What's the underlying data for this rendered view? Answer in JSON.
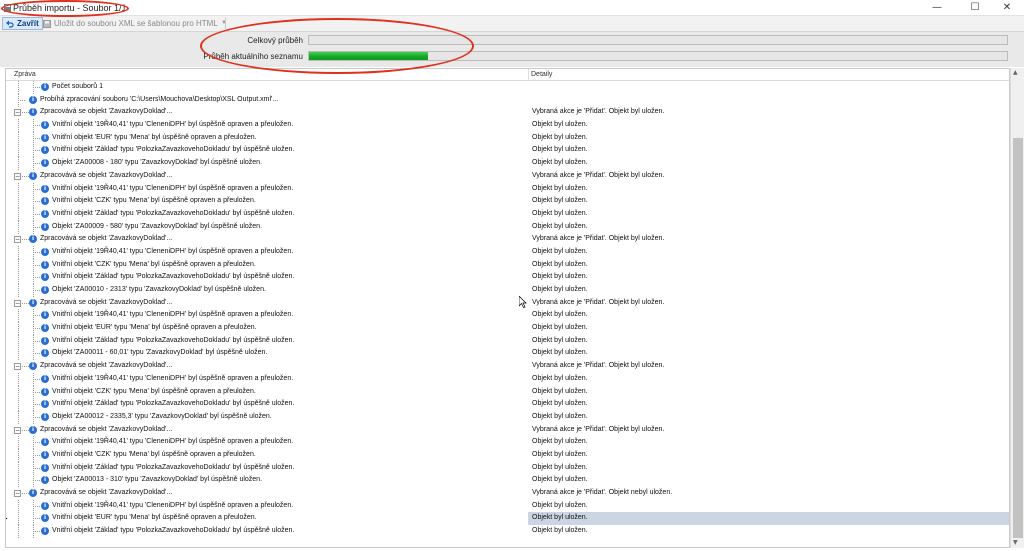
{
  "window": {
    "title": "Průběh importu - Soubor 1/1",
    "buttons": {
      "minimize": "—",
      "maximize": "☐",
      "close": "✕"
    }
  },
  "toolbar": {
    "close_label": "Zavřít",
    "save_label": "Uložit do souboru XML se šablonou pro HTML"
  },
  "progress": {
    "total_label": "Celkový průběh",
    "total_value": 0,
    "current_label": "Průběh aktuálního seznamu",
    "current_value": 0.17
  },
  "grid": {
    "columns": [
      "Zpráva",
      "Detaily"
    ],
    "rows": [
      {
        "level": 2,
        "message": "Počet souborů 1",
        "detail": ""
      },
      {
        "level": 1,
        "message": "Probíhá zpracování souboru 'C:\\Users\\Mouchova\\Desktop\\XSL Output.xml'...",
        "detail": ""
      },
      {
        "level": 1,
        "expand": true,
        "message": "Zpracovává se objekt 'ZavazkovyDoklad'...",
        "detail": "Vybraná akce je 'Přidat'. Objekt byl uložen."
      },
      {
        "level": 2,
        "message": "Vnitřní objekt '19Ř40,41' typu 'CleneniDPH' byl úspěšně opraven a přeuložen.",
        "detail": "Objekt byl uložen."
      },
      {
        "level": 2,
        "message": "Vnitřní objekt 'EUR' typu 'Mena' byl úspěšně opraven a přeuložen.",
        "detail": "Objekt byl uložen."
      },
      {
        "level": 2,
        "message": "Vnitřní objekt 'Základ' typu 'PolozkaZavazkovehoDokladu' byl úspěšně uložen.",
        "detail": "Objekt byl uložen."
      },
      {
        "level": 2,
        "message": "Objekt 'ZA00008 - 180' typu 'ZavazkovyDoklad' byl úspěšně uložen.",
        "detail": "Objekt byl uložen."
      },
      {
        "level": 1,
        "expand": true,
        "message": "Zpracovává se objekt 'ZavazkovyDoklad'...",
        "detail": "Vybraná akce je 'Přidat'. Objekt byl uložen."
      },
      {
        "level": 2,
        "message": "Vnitřní objekt '19Ř40,41' typu 'CleneniDPH' byl úspěšně opraven a přeuložen.",
        "detail": "Objekt byl uložen."
      },
      {
        "level": 2,
        "message": "Vnitřní objekt 'CZK' typu 'Mena' byl úspěšně opraven a přeuložen.",
        "detail": "Objekt byl uložen."
      },
      {
        "level": 2,
        "message": "Vnitřní objekt 'Základ' typu 'PolozkaZavazkovehoDokladu' byl úspěšně uložen.",
        "detail": "Objekt byl uložen."
      },
      {
        "level": 2,
        "message": "Objekt 'ZA00009 - 580' typu 'ZavazkovyDoklad' byl úspěšně uložen.",
        "detail": "Objekt byl uložen."
      },
      {
        "level": 1,
        "expand": true,
        "message": "Zpracovává se objekt 'ZavazkovyDoklad'...",
        "detail": "Vybraná akce je 'Přidat'. Objekt byl uložen."
      },
      {
        "level": 2,
        "message": "Vnitřní objekt '19Ř40,41' typu 'CleneniDPH' byl úspěšně opraven a přeuložen.",
        "detail": "Objekt byl uložen."
      },
      {
        "level": 2,
        "message": "Vnitřní objekt 'CZK' typu 'Mena' byl úspěšně opraven a přeuložen.",
        "detail": "Objekt byl uložen."
      },
      {
        "level": 2,
        "message": "Vnitřní objekt 'Základ' typu 'PolozkaZavazkovehoDokladu' byl úspěšně uložen.",
        "detail": "Objekt byl uložen."
      },
      {
        "level": 2,
        "message": "Objekt 'ZA00010 - 2313' typu 'ZavazkovyDoklad' byl úspěšně uložen.",
        "detail": "Objekt byl uložen."
      },
      {
        "level": 1,
        "expand": true,
        "message": "Zpracovává se objekt 'ZavazkovyDoklad'...",
        "detail": "Vybraná akce je 'Přidat'. Objekt byl uložen."
      },
      {
        "level": 2,
        "message": "Vnitřní objekt '19Ř40,41' typu 'CleneniDPH' byl úspěšně opraven a přeuložen.",
        "detail": "Objekt byl uložen."
      },
      {
        "level": 2,
        "message": "Vnitřní objekt 'EUR' typu 'Mena' byl úspěšně opraven a přeuložen.",
        "detail": "Objekt byl uložen."
      },
      {
        "level": 2,
        "message": "Vnitřní objekt 'Základ' typu 'PolozkaZavazkovehoDokladu' byl úspěšně uložen.",
        "detail": "Objekt byl uložen."
      },
      {
        "level": 2,
        "message": "Objekt 'ZA00011 - 60,01' typu 'ZavazkovyDoklad' byl úspěšně uložen.",
        "detail": "Objekt byl uložen."
      },
      {
        "level": 1,
        "expand": true,
        "message": "Zpracovává se objekt 'ZavazkovyDoklad'...",
        "detail": "Vybraná akce je 'Přidat'. Objekt byl uložen."
      },
      {
        "level": 2,
        "message": "Vnitřní objekt '19Ř40,41' typu 'CleneniDPH' byl úspěšně opraven a přeuložen.",
        "detail": "Objekt byl uložen."
      },
      {
        "level": 2,
        "message": "Vnitřní objekt 'CZK' typu 'Mena' byl úspěšně opraven a přeuložen.",
        "detail": "Objekt byl uložen."
      },
      {
        "level": 2,
        "message": "Vnitřní objekt 'Základ' typu 'PolozkaZavazkovehoDokladu' byl úspěšně uložen.",
        "detail": "Objekt byl uložen."
      },
      {
        "level": 2,
        "message": "Objekt 'ZA00012 - 2335,3' typu 'ZavazkovyDoklad' byl úspěšně uložen.",
        "detail": "Objekt byl uložen."
      },
      {
        "level": 1,
        "expand": true,
        "message": "Zpracovává se objekt 'ZavazkovyDoklad'...",
        "detail": "Vybraná akce je 'Přidat'. Objekt byl uložen."
      },
      {
        "level": 2,
        "message": "Vnitřní objekt '19Ř40,41' typu 'CleneniDPH' byl úspěšně opraven a přeuložen.",
        "detail": "Objekt byl uložen."
      },
      {
        "level": 2,
        "message": "Vnitřní objekt 'CZK' typu 'Mena' byl úspěšně opraven a přeuložen.",
        "detail": "Objekt byl uložen."
      },
      {
        "level": 2,
        "message": "Vnitřní objekt 'Základ' typu 'PolozkaZavazkovehoDokladu' byl úspěšně uložen.",
        "detail": "Objekt byl uložen."
      },
      {
        "level": 2,
        "message": "Objekt 'ZA00013 - 310' typu 'ZavazkovyDoklad' byl úspěšně uložen.",
        "detail": "Objekt byl uložen."
      },
      {
        "level": 1,
        "expand": true,
        "message": "Zpracovává se objekt 'ZavazkovyDoklad'...",
        "detail": "Vybraná akce je 'Přidat'. Objekt nebyl uložen."
      },
      {
        "level": 2,
        "message": "Vnitřní objekt '19Ř40,41' typu 'CleneniDPH' byl úspěšně opraven a přeuložen.",
        "detail": "Objekt byl uložen."
      },
      {
        "level": 2,
        "message": "Vnitřní objekt 'EUR' typu 'Mena' byl úspěšně opraven a přeuložen.",
        "detail": "Objekt byl uložen.",
        "selected": true
      },
      {
        "level": 2,
        "message": "Vnitřní objekt 'Základ' typu 'PolozkaZavazkovehoDokladu' byl úspěšně uložen.",
        "detail": "Objekt byl uložen."
      }
    ]
  },
  "colors": {
    "annotation": "#e0301e",
    "progress_fill": "#15a526",
    "info_icon": "#2a6ed3",
    "selected_row": "#ccd5e2"
  }
}
